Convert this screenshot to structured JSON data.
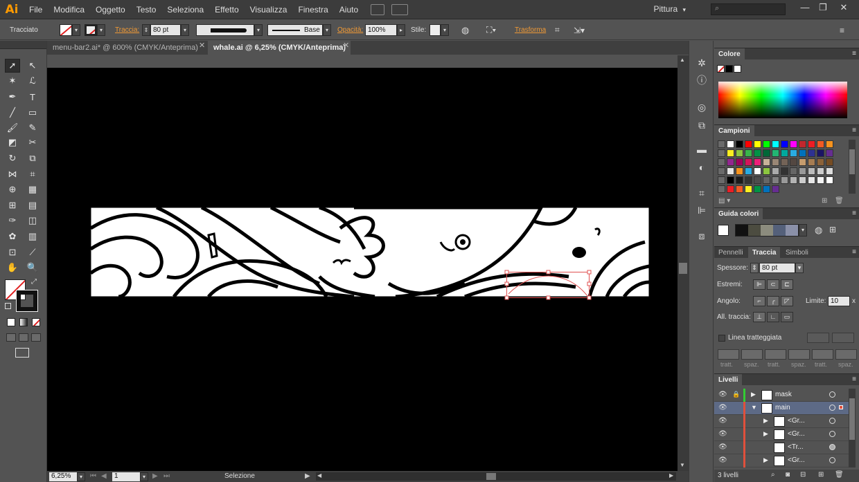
{
  "app": {
    "logo": "Ai"
  },
  "menu": [
    "File",
    "Modifica",
    "Oggetto",
    "Testo",
    "Seleziona",
    "Effetto",
    "Visualizza",
    "Finestra",
    "Aiuto"
  ],
  "workspace": {
    "label": "Pittura",
    "arrow": "▾"
  },
  "search": {
    "icon": "⌕"
  },
  "window_controls": {
    "minimize": "—",
    "restore": "❐",
    "close": "✕"
  },
  "control_bar": {
    "selection_type": "Tracciato",
    "stroke_label": "Traccia:",
    "stroke_value": "80 pt",
    "profile_label": "Base",
    "opacity_label": "Opacità:",
    "opacity_value": "100%",
    "style_label": "Stile:",
    "transform_label": "Trasforma"
  },
  "tabs": [
    {
      "label": "menu-bar2.ai* @ 600% (CMYK/Anteprima)",
      "close": "✕",
      "active": false
    },
    {
      "label": "whale.ai @ 6,25% (CMYK/Anteprima)",
      "close": "✕",
      "active": true
    }
  ],
  "status": {
    "zoom": "6,25%",
    "artboard": "1",
    "tool": "Selezione"
  },
  "panels": {
    "color": {
      "title": "Colore"
    },
    "swatches": {
      "title": "Campioni",
      "rows": [
        [
          "#ffffff",
          "#000000",
          "#ff0000",
          "#ffff00",
          "#00ff00",
          "#00ffff",
          "#0000ff",
          "#ff00ff",
          "#c1272d",
          "#ed1c24",
          "#f15a24",
          "#f7931e"
        ],
        [
          "#fcee21",
          "#8cc63f",
          "#39b54a",
          "#009245",
          "#006837",
          "#22b573",
          "#00a99d",
          "#29abe2",
          "#0071bc",
          "#2e3192",
          "#1b1464",
          "#662d91"
        ],
        [
          "#93278f",
          "#9e005d",
          "#d4145a",
          "#ed1e79",
          "#c7b299",
          "#998675",
          "#736357",
          "#534741",
          "#c69c6d",
          "#a67c52",
          "#8c6239",
          "#754c24"
        ],
        [
          "#e6e6e6",
          "#f7931e",
          "#29abe2",
          "#ffffff",
          "#8cc63f",
          "#aaaaaa",
          "#333333",
          "#666666",
          "#999999",
          "#bbbbbb",
          "#cccccc",
          "#dddddd"
        ],
        [
          "#000000",
          "#1a1a1a",
          "#333333",
          "#4d4d4d",
          "#666666",
          "#808080",
          "#999999",
          "#b3b3b3",
          "#cccccc",
          "#e6e6e6",
          "#f2f2f2",
          "#ffffff"
        ],
        [
          "#ed1c24",
          "#f15a24",
          "#fcee21",
          "#009245",
          "#0071bc",
          "#662d91"
        ]
      ]
    },
    "color_guide": {
      "title": "Guida colori"
    },
    "stroke": {
      "tabs": [
        "Pennelli",
        "Traccia",
        "Simboli"
      ],
      "weight_label": "Spessore:",
      "weight_value": "80 pt",
      "caps_label": "Estremi:",
      "corner_label": "Angolo:",
      "limit_label": "Limite:",
      "limit_value": "10",
      "limit_unit": "x",
      "align_label": "All. traccia:",
      "dashed_label": "Linea tratteggiata",
      "dash_labels": [
        "tratt.",
        "spaz.",
        "tratt.",
        "spaz.",
        "tratt.",
        "spaz."
      ]
    },
    "layers": {
      "title": "Livelli",
      "rows": [
        {
          "name": "mask",
          "color": "#33cc33",
          "selected": false,
          "expanded": false,
          "indent": 0
        },
        {
          "name": "main",
          "color": "#e0503c",
          "selected": true,
          "expanded": true,
          "indent": 0
        },
        {
          "name": "<Gr...",
          "color": "#e0503c",
          "selected": false,
          "expanded": false,
          "indent": 1
        },
        {
          "name": "<Gr...",
          "color": "#e0503c",
          "selected": false,
          "expanded": false,
          "indent": 1
        },
        {
          "name": "<Tr...",
          "color": "#e0503c",
          "selected": false,
          "expanded": false,
          "indent": 1
        },
        {
          "name": "<Gr...",
          "color": "#e0503c",
          "selected": false,
          "expanded": false,
          "indent": 1
        }
      ],
      "footer": "3 livelli"
    }
  }
}
